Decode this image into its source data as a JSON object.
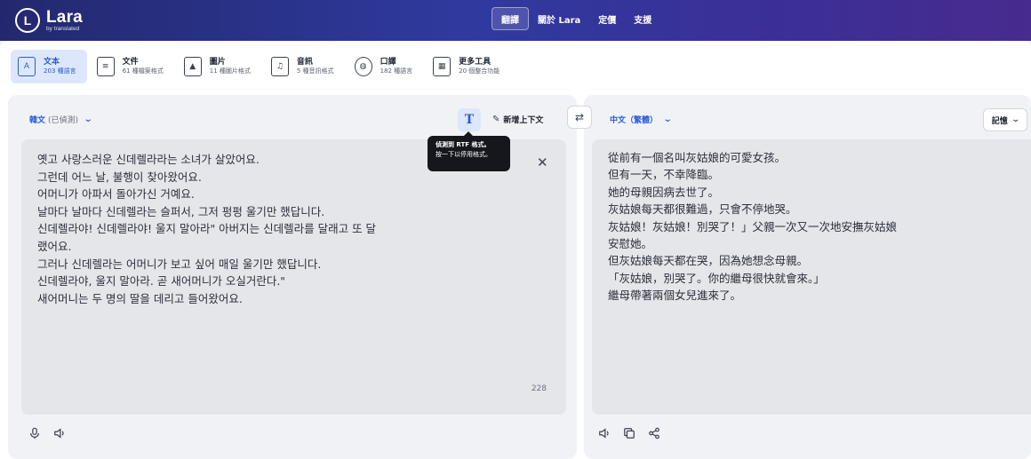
{
  "brand": {
    "name": "Lara",
    "sub": "by translated",
    "mark": "L"
  },
  "nav": [
    {
      "label": "翻譯",
      "active": true
    },
    {
      "label": "關於 Lara",
      "active": false
    },
    {
      "label": "定價",
      "active": false
    },
    {
      "label": "支援",
      "active": false
    }
  ],
  "tools": [
    {
      "label": "文本",
      "sub": "203 種語言",
      "icon": "text-icon",
      "glyph": "A",
      "active": true
    },
    {
      "label": "文件",
      "sub": "61 種檔案格式",
      "icon": "document-icon",
      "glyph": "≡",
      "active": false
    },
    {
      "label": "圖片",
      "sub": "11 種圖片格式",
      "icon": "image-icon",
      "glyph": "▲",
      "active": false
    },
    {
      "label": "音訊",
      "sub": "5 種音訊格式",
      "icon": "audio-icon",
      "glyph": "♫",
      "active": false
    },
    {
      "label": "口譯",
      "sub": "182 種語言",
      "icon": "interpret-icon",
      "glyph": "◍",
      "active": false
    },
    {
      "label": "更多工具",
      "sub": "20 個整合功能",
      "icon": "grid-icon",
      "glyph": "▦",
      "active": false
    }
  ],
  "source": {
    "language": "韓文",
    "detected": "(已偵測)",
    "rtf_glyph": "T",
    "context_label": "新增上下文",
    "text": "옛고 사랑스러운 신데렐라라는 소녀가 살았어요.\n그런데 어느 날, 불행이 찾아왔어요.\n어머니가 아파서 돌아가신 거예요.\n날마다 날마다 신데렐라는 슬퍼서, 그저 펑펑 울기만 했답니다.\n신데렐라야! 신데렐라야! 울지 말아라\" 아버지는 신데렐라를 달래고 또 달\n랬어요.\n그러나 신데렐라는 어머니가 보고 싶어 매일 울기만 했답니다.\n신데렐라야, 울지 말아라. 곧 새어머니가 오실거란다.\"\n새어머니는 두 명의 딸을 데리고 들어왔어요.",
    "char_count": "228"
  },
  "tooltip": {
    "title": "偵測到 RTF 格式。",
    "body": "按一下以停用格式。"
  },
  "target": {
    "language": "中文（繁體）",
    "memory_label": "記憶",
    "text": "從前有一個名叫灰姑娘的可愛女孩。\n但有一天，不幸降臨。\n她的母親因病去世了。\n灰姑娘每天都很難過，只會不停地哭。\n灰姑娘！灰姑娘！別哭了！」父親一次又一次地安撫灰姑娘\n安慰她。\n但灰姑娘每天都在哭，因為她想念母親。\n「灰姑娘，別哭了。你的繼母很快就會來。」\n繼母帶著兩個女兒進來了。"
  },
  "icons": {
    "swap": "⇄",
    "clear": "✕",
    "chevron": "⌄"
  }
}
